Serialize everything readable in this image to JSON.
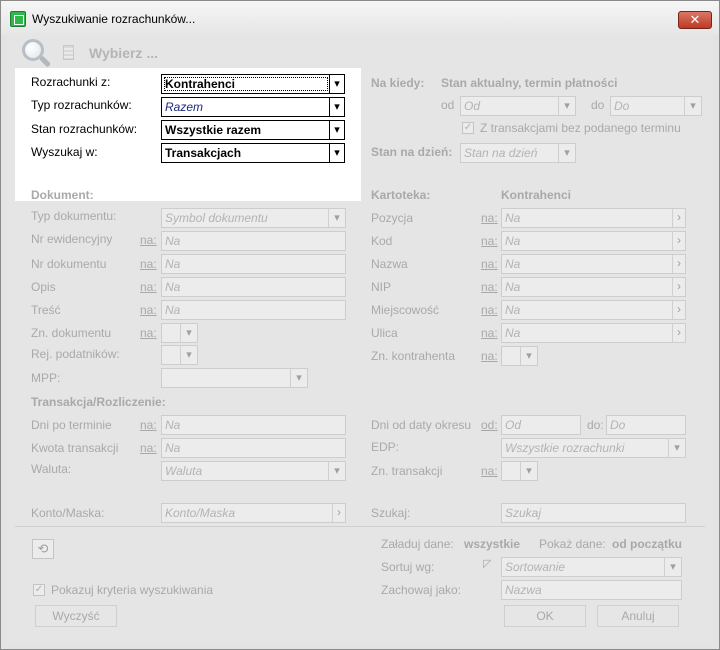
{
  "window": {
    "title": "Wyszukiwanie rozrachunków...",
    "close_label": "✕"
  },
  "toolbar": {
    "select_label": "Wybierz ..."
  },
  "top": {
    "rozrachunki_z": {
      "label": "Rozrachunki z:",
      "value": "Kontrahenci"
    },
    "typ": {
      "label": "Typ rozrachunków:",
      "value": "Razem"
    },
    "stan": {
      "label": "Stan rozrachunków:",
      "value": "Wszystkie razem"
    },
    "wyszukaj": {
      "label": "Wyszukaj w:",
      "value": "Transakcjach"
    }
  },
  "na_kiedy": {
    "label": "Na kiedy:",
    "value": "Stan aktualny, termin płatności",
    "od_label": "od",
    "od_placeholder": "Od",
    "do_label": "do",
    "do_placeholder": "Do",
    "checkbox_label": "Z transakcjami bez podanego terminu",
    "stan_label": "Stan na dzień:",
    "stan_placeholder": "Stan na dzień"
  },
  "dokument": {
    "header": "Dokument:",
    "typ_label": "Typ dokumentu:",
    "typ_placeholder": "Symbol dokumentu",
    "nr_ewid_label": "Nr ewidencyjny",
    "nr_dok_label": "Nr dokumentu",
    "opis_label": "Opis",
    "tresc_label": "Treść",
    "zn_label": "Zn. dokumentu",
    "rej_label": "Rej. podatników:",
    "mpp_label": "MPP:",
    "na_label": "na:",
    "na_placeholder": "Na"
  },
  "kartoteka": {
    "header": "Kartoteka:",
    "value": "Kontrahenci",
    "pozycja_label": "Pozycja",
    "kod_label": "Kod",
    "nazwa_label": "Nazwa",
    "nip_label": "NIP",
    "miejscowosc_label": "Miejscowość",
    "ulica_label": "Ulica",
    "zn_label": "Zn. kontrahenta"
  },
  "transakcja": {
    "header": "Transakcja/Rozliczenie:",
    "dni_label": "Dni po terminie",
    "kwota_label": "Kwota transakcji",
    "waluta_label": "Waluta:",
    "waluta_placeholder": "Waluta",
    "dni_okresu_label": "Dni od daty okresu",
    "od_label": "od:",
    "od_placeholder": "Od",
    "do_label": "do:",
    "do_placeholder": "Do",
    "edp_label": "EDP:",
    "edp_placeholder": "Wszystkie rozrachunki",
    "zn_label": "Zn. transakcji"
  },
  "konto": {
    "label": "Konto/Maska:",
    "placeholder": "Konto/Maska"
  },
  "szukaj": {
    "label": "Szukaj:",
    "placeholder": "Szukaj"
  },
  "bottom": {
    "zaladuj_label": "Załaduj dane:",
    "zaladuj_value": "wszystkie",
    "pokaz_label": "Pokaż dane:",
    "pokaz_value": "od początku",
    "sortuj_label": "Sortuj wg:",
    "sortuj_placeholder": "Sortowanie",
    "zachowaj_label": "Zachowaj jako:",
    "zachowaj_placeholder": "Nazwa",
    "pokazuj_label": "Pokazuj kryteria wyszukiwania",
    "wyczysc_label": "Wyczyść",
    "ok_label": "OK",
    "anuluj_label": "Anuluj"
  }
}
